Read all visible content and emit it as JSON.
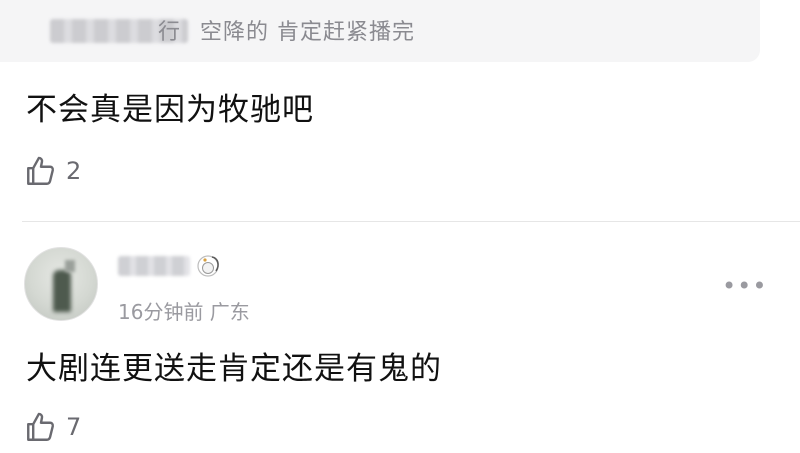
{
  "quoted_reply": {
    "author_name_visible_part": "行",
    "text": "空降的 肯定赶紧播完"
  },
  "comment_1": {
    "text": "不会真是因为牧驰吧",
    "like_count": "2",
    "like_icon": "thumbs-up-outline-icon"
  },
  "comment_2": {
    "time": "16分钟前",
    "location": "广东",
    "meta": "16分钟前 广东",
    "more_icon": "more-dots-icon",
    "more_glyph": "•••",
    "text": "大剧连更送走肯定还是有鬼的",
    "like_count": "7",
    "like_icon": "thumbs-up-outline-icon"
  }
}
